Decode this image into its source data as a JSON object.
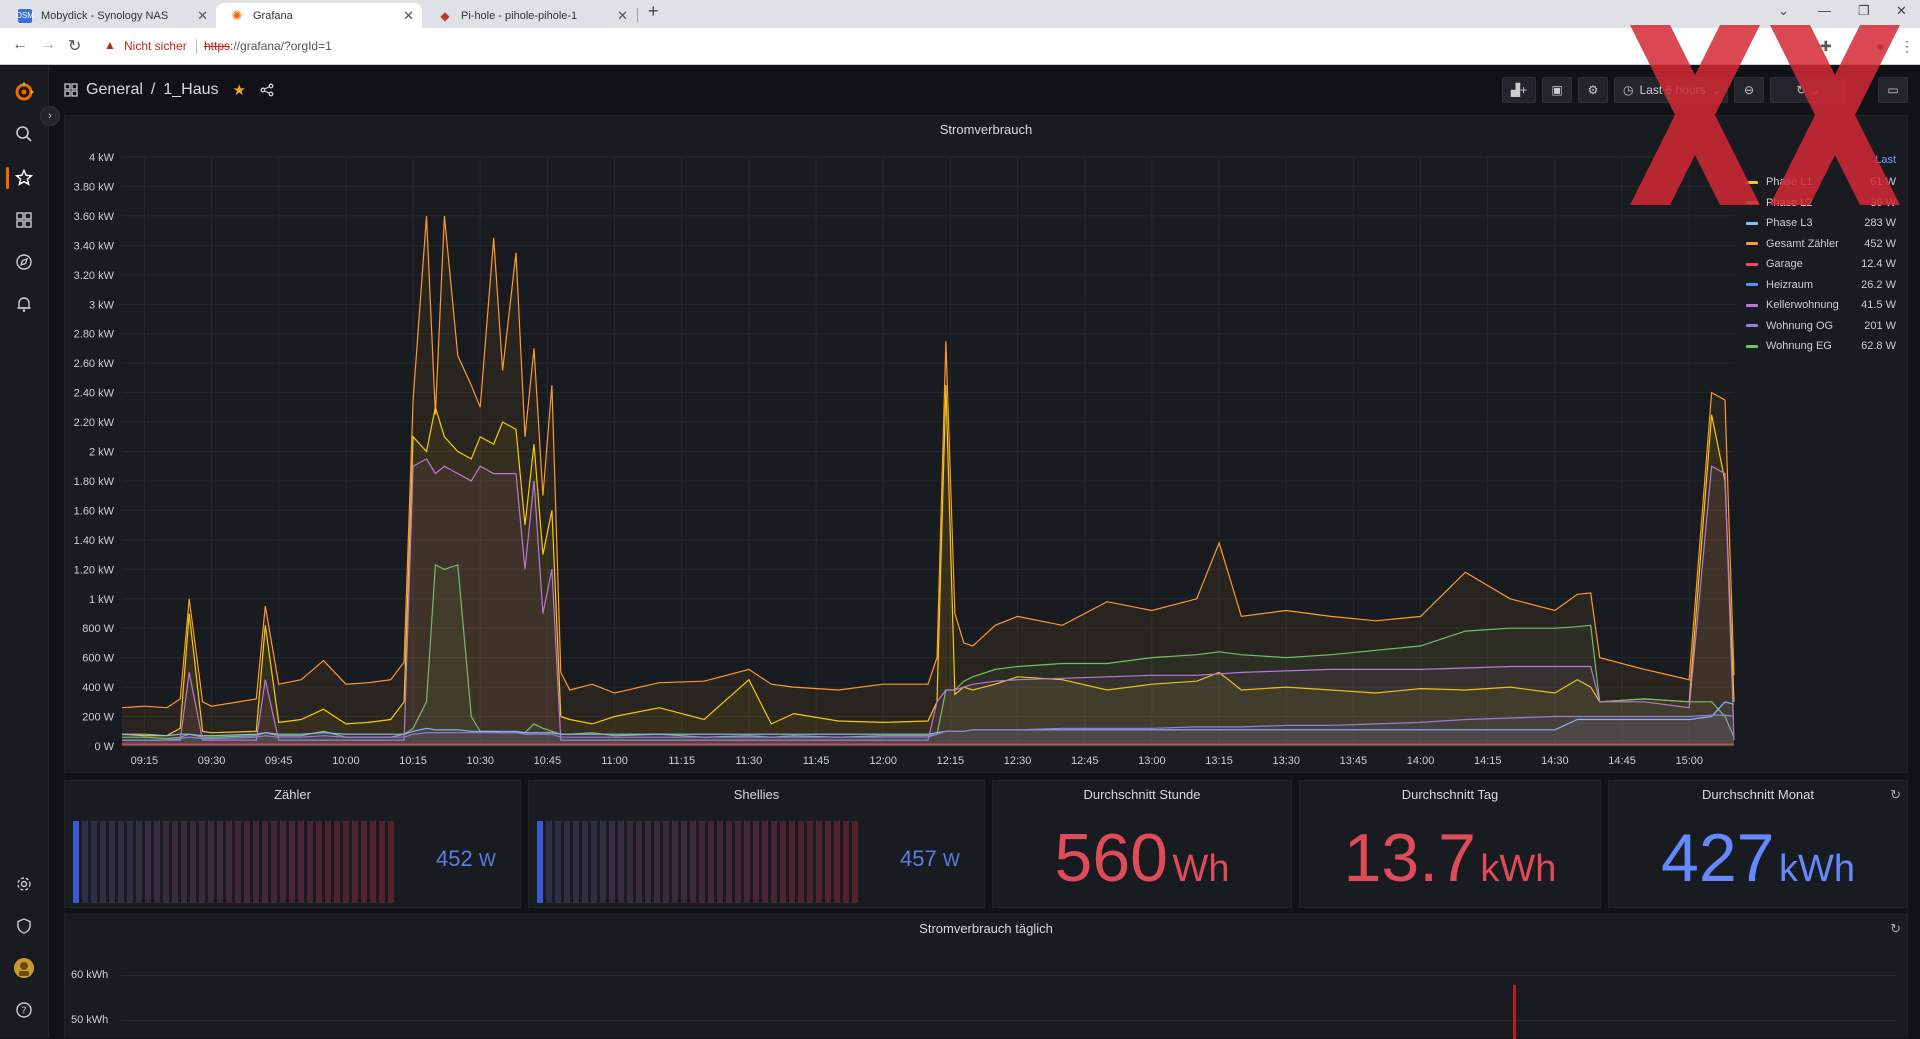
{
  "browser": {
    "tabs": [
      {
        "title": "Mobydick - Synology NAS",
        "favicon_label": "DSM"
      },
      {
        "title": "Grafana"
      },
      {
        "title": "Pi-hole - pihole-pihole-1"
      }
    ],
    "insecure_label": "Nicht sicher",
    "url_scheme": "https",
    "url_rest": "://grafana/?orgId=1"
  },
  "header": {
    "folder": "General",
    "separator": "/",
    "dashboard": "1_Haus",
    "time_picker_label": "Last 6 hours"
  },
  "main_chart": {
    "title": "Stromverbrauch",
    "legend_header": "Last",
    "y_ticks": [
      "0 W",
      "200 W",
      "400 W",
      "600 W",
      "800 W",
      "1 kW",
      "1.20 kW",
      "1.40 kW",
      "1.60 kW",
      "1.80 kW",
      "2 kW",
      "2.20 kW",
      "2.40 kW",
      "2.60 kW",
      "2.80 kW",
      "3 kW",
      "3.20 kW",
      "3.40 kW",
      "3.60 kW",
      "3.80 kW",
      "4 kW"
    ],
    "x_ticks": [
      "09:15",
      "09:30",
      "09:45",
      "10:00",
      "10:15",
      "10:30",
      "10:45",
      "11:00",
      "11:15",
      "11:30",
      "11:45",
      "12:00",
      "12:15",
      "12:30",
      "12:45",
      "13:00",
      "13:15",
      "13:30",
      "13:45",
      "14:00",
      "14:15",
      "14:30",
      "14:45",
      "15:00"
    ],
    "legend": [
      {
        "name": "Phase L1",
        "last": "61 W",
        "color": "#f2cc0c"
      },
      {
        "name": "Phase L2",
        "last": "36 W",
        "color": "#73bf69"
      },
      {
        "name": "Phase L3",
        "last": "283 W",
        "color": "#8ab8ff"
      },
      {
        "name": "Gesamt Zähler",
        "last": "452 W",
        "color": "#ff9830"
      },
      {
        "name": "Garage",
        "last": "12.4 W",
        "color": "#f2495c"
      },
      {
        "name": "Heizraum",
        "last": "26.2 W",
        "color": "#5794f2"
      },
      {
        "name": "Kellerwohnung",
        "last": "41.5 W",
        "color": "#b877d9"
      },
      {
        "name": "Wohnung OG",
        "last": "201 W",
        "color": "#8f7fdc"
      },
      {
        "name": "Wohnung EG",
        "last": "62.8 W",
        "color": "#73bf69"
      }
    ]
  },
  "chart_data": {
    "type": "line",
    "title": "Stromverbrauch",
    "ylim": [
      0,
      4000
    ],
    "y_unit": "W",
    "x": [
      "09:10",
      "09:15",
      "09:20",
      "09:23",
      "09:25",
      "09:28",
      "09:30",
      "09:40",
      "09:42",
      "09:45",
      "09:50",
      "09:55",
      "10:00",
      "10:05",
      "10:10",
      "10:13",
      "10:15",
      "10:18",
      "10:20",
      "10:22",
      "10:25",
      "10:28",
      "10:30",
      "10:33",
      "10:35",
      "10:38",
      "10:40",
      "10:42",
      "10:44",
      "10:46",
      "10:48",
      "10:50",
      "10:55",
      "11:00",
      "11:10",
      "11:20",
      "11:30",
      "11:35",
      "11:40",
      "11:50",
      "12:00",
      "12:10",
      "12:12",
      "12:14",
      "12:16",
      "12:18",
      "12:20",
      "12:25",
      "12:30",
      "12:40",
      "12:50",
      "13:00",
      "13:10",
      "13:15",
      "13:20",
      "13:30",
      "13:40",
      "13:50",
      "14:00",
      "14:10",
      "14:20",
      "14:30",
      "14:35",
      "14:38",
      "14:40",
      "14:50",
      "15:00",
      "15:05",
      "15:08",
      "15:10"
    ],
    "series": [
      {
        "name": "Gesamt Zähler",
        "values": [
          260,
          270,
          260,
          320,
          1000,
          300,
          270,
          320,
          950,
          420,
          450,
          580,
          420,
          430,
          450,
          570,
          2350,
          3600,
          2250,
          3600,
          2650,
          2450,
          2300,
          3450,
          2550,
          3350,
          2100,
          2700,
          1700,
          2450,
          500,
          380,
          420,
          360,
          430,
          440,
          520,
          420,
          400,
          380,
          420,
          420,
          600,
          2750,
          900,
          700,
          680,
          820,
          880,
          820,
          980,
          920,
          1000,
          1380,
          880,
          920,
          880,
          850,
          880,
          1180,
          1000,
          920,
          1030,
          1040,
          600,
          520,
          450,
          2400,
          2350,
          480
        ]
      },
      {
        "name": "Phase L1",
        "values": [
          80,
          70,
          70,
          120,
          900,
          100,
          90,
          100,
          820,
          160,
          180,
          250,
          150,
          160,
          180,
          300,
          2100,
          2000,
          2300,
          2100,
          2000,
          1950,
          2100,
          2050,
          2200,
          2150,
          1500,
          2050,
          1300,
          1600,
          200,
          180,
          150,
          200,
          260,
          180,
          450,
          150,
          220,
          170,
          160,
          170,
          300,
          2450,
          350,
          400,
          380,
          420,
          470,
          450,
          380,
          420,
          440,
          500,
          380,
          400,
          380,
          360,
          390,
          380,
          400,
          360,
          450,
          400,
          300,
          320,
          300,
          2250,
          1800,
          300
        ]
      },
      {
        "name": "Phase L2",
        "values": [
          60,
          60,
          50,
          60,
          80,
          60,
          60,
          70,
          90,
          70,
          70,
          100,
          60,
          60,
          60,
          80,
          120,
          300,
          1230,
          1200,
          1230,
          200,
          100,
          100,
          90,
          90,
          90,
          150,
          120,
          100,
          80,
          80,
          90,
          70,
          80,
          60,
          70,
          60,
          70,
          60,
          70,
          70,
          80,
          380,
          380,
          440,
          470,
          520,
          540,
          560,
          560,
          600,
          620,
          640,
          620,
          600,
          620,
          650,
          680,
          780,
          800,
          800,
          810,
          820,
          300,
          320,
          300,
          300,
          200,
          60
        ]
      },
      {
        "name": "Phase L3",
        "values": [
          80,
          80,
          70,
          80,
          80,
          70,
          70,
          80,
          90,
          80,
          80,
          90,
          80,
          80,
          80,
          80,
          100,
          120,
          110,
          110,
          110,
          100,
          100,
          100,
          100,
          100,
          90,
          90,
          90,
          90,
          80,
          80,
          80,
          80,
          80,
          80,
          80,
          80,
          80,
          80,
          80,
          80,
          90,
          100,
          100,
          100,
          110,
          110,
          110,
          110,
          110,
          110,
          110,
          110,
          110,
          110,
          110,
          110,
          110,
          110,
          110,
          110,
          180,
          180,
          180,
          180,
          180,
          200,
          300,
          283
        ]
      },
      {
        "name": "Kellerwohnung",
        "values": [
          40,
          40,
          40,
          40,
          500,
          40,
          40,
          40,
          450,
          40,
          40,
          40,
          40,
          40,
          40,
          40,
          1900,
          1950,
          1850,
          1900,
          1850,
          1800,
          1900,
          1850,
          1850,
          1850,
          1200,
          1800,
          900,
          1200,
          40,
          40,
          40,
          40,
          40,
          40,
          40,
          40,
          40,
          40,
          40,
          40,
          300,
          380,
          380,
          400,
          420,
          440,
          450,
          460,
          470,
          480,
          480,
          490,
          500,
          510,
          520,
          520,
          520,
          530,
          540,
          540,
          540,
          540,
          300,
          300,
          260,
          1900,
          1850,
          40
        ]
      },
      {
        "name": "Wohnung OG",
        "values": [
          40,
          40,
          40,
          50,
          60,
          50,
          50,
          60,
          70,
          60,
          60,
          70,
          60,
          60,
          60,
          60,
          80,
          90,
          90,
          90,
          90,
          90,
          90,
          90,
          90,
          90,
          80,
          80,
          80,
          80,
          60,
          60,
          60,
          60,
          60,
          60,
          60,
          60,
          60,
          60,
          60,
          60,
          80,
          100,
          100,
          100,
          110,
          110,
          110,
          120,
          120,
          120,
          130,
          130,
          130,
          140,
          140,
          150,
          160,
          180,
          190,
          200,
          200,
          200,
          200,
          200,
          200,
          210,
          210,
          201
        ]
      },
      {
        "name": "Garage",
        "values": [
          12,
          12,
          12,
          12,
          12,
          12,
          12,
          12,
          12,
          12,
          12,
          12,
          12,
          12,
          12,
          12,
          12,
          12,
          12,
          12,
          12,
          12,
          12,
          12,
          12,
          12,
          12,
          12,
          12,
          12,
          12,
          12,
          12,
          12,
          12,
          12,
          12,
          12,
          12,
          12,
          12,
          12,
          12,
          12,
          12,
          12,
          12,
          12,
          12,
          12,
          12,
          12,
          12,
          12,
          12,
          12,
          12,
          12,
          12,
          12,
          12,
          12,
          12,
          12,
          12,
          12,
          12,
          12,
          12,
          12
        ]
      }
    ]
  },
  "stats": {
    "zaehler": {
      "title": "Zähler",
      "value": "452",
      "unit": "W"
    },
    "shellies": {
      "title": "Shellies",
      "value": "457",
      "unit": "W"
    },
    "std": {
      "title": "Durchschnitt Stunde",
      "value": "560",
      "unit": "Wh",
      "color": "#e04b59"
    },
    "tag": {
      "title": "Durchschnitt Tag",
      "value": "13.7",
      "unit": "kWh",
      "color": "#e04b59"
    },
    "monat": {
      "title": "Durchschnitt Monat",
      "value": "427",
      "unit": "kWh",
      "color": "#6688ff"
    }
  },
  "daily": {
    "title": "Stromverbrauch täglich",
    "y_ticks": [
      "60 kWh",
      "50 kWh"
    ]
  },
  "colors": {
    "grafana_orange": "#f46800",
    "bg": "#111217",
    "panel": "#181b1f"
  }
}
